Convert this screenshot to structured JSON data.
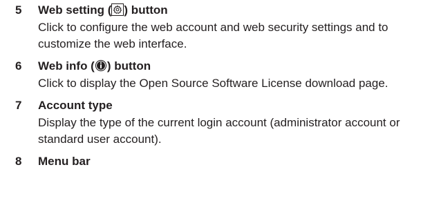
{
  "items": [
    {
      "number": "5",
      "title_pre": "Web setting (",
      "title_post": ") button",
      "icon": "gear-icon",
      "description": "Click to configure the web account and web security settings and to customize the web interface."
    },
    {
      "number": "6",
      "title_pre": "Web info (",
      "title_post": ") button",
      "icon": "info-icon",
      "description": "Click to display the Open Source Software License download page."
    },
    {
      "number": "7",
      "title": "Account type",
      "description": "Display the type of the current login account (administrator account or standard user account)."
    },
    {
      "number": "8",
      "title": "Menu bar"
    }
  ]
}
